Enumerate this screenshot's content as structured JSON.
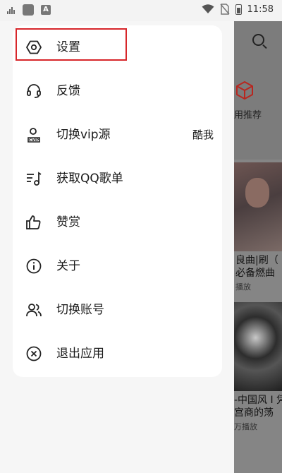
{
  "status_bar": {
    "time": "11:58",
    "notification_icon_label": "A"
  },
  "menu": {
    "items": [
      {
        "id": "settings",
        "label": "设置",
        "icon": "settings-hexagon-icon",
        "highlighted": true
      },
      {
        "id": "feedback",
        "label": "反馈",
        "icon": "headset-icon"
      },
      {
        "id": "switch-vip",
        "label": "切换vip源",
        "icon": "vip-user-icon",
        "value": "酷我"
      },
      {
        "id": "import-qq",
        "label": "获取QQ歌单",
        "icon": "playlist-music-icon"
      },
      {
        "id": "reward",
        "label": "赞赏",
        "icon": "thumbs-up-icon"
      },
      {
        "id": "about",
        "label": "关于",
        "icon": "info-icon"
      },
      {
        "id": "switch-account",
        "label": "切换账号",
        "icon": "users-icon"
      },
      {
        "id": "exit",
        "label": "退出应用",
        "icon": "close-circle-icon"
      }
    ]
  },
  "background_app": {
    "recommend_label": "用推荐",
    "card1_title_line1": "良曲|刷（",
    "card1_title_line2": "必备燃曲",
    "card1_meta": "播放",
    "card2_title_line1": "-中国风 I 凭",
    "card2_title_line2": "宫商的荡",
    "card2_meta": "万播放"
  },
  "colors": {
    "highlight_border": "#d7262a",
    "drawer_bg": "#f6f6f6",
    "card_bg": "#ffffff",
    "scrim": "#7a7a7a"
  }
}
